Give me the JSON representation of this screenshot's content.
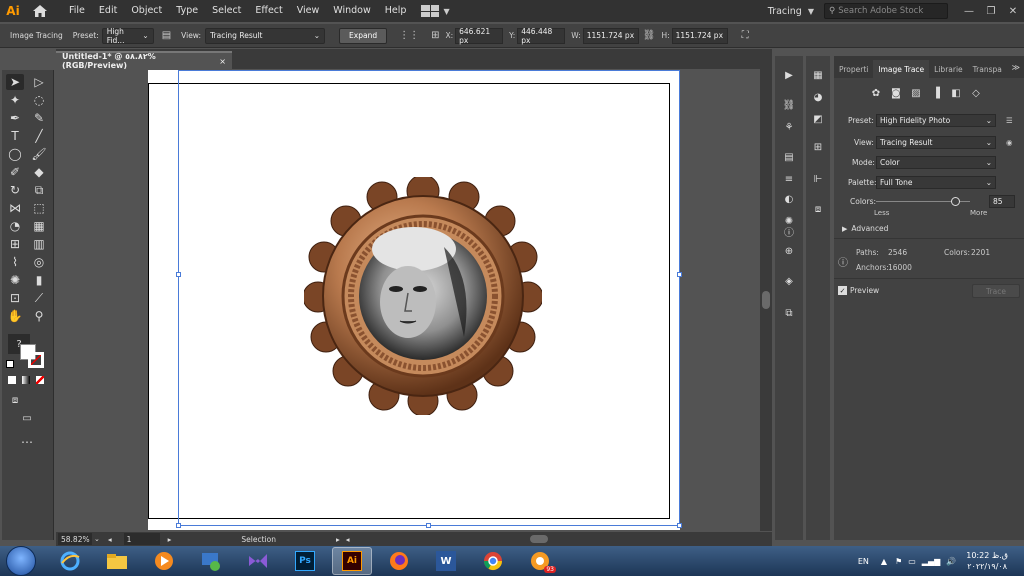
{
  "menubar": {
    "logo": "Ai",
    "items": [
      "File",
      "Edit",
      "Object",
      "Type",
      "Select",
      "Effect",
      "View",
      "Window",
      "Help"
    ],
    "workspace_label": "Tracing",
    "search_placeholder": "Search Adobe Stock",
    "window_buttons": [
      "—",
      "❐",
      "✕"
    ]
  },
  "controlbar": {
    "image_tracing_label": "Image Tracing",
    "preset_label": "Preset:",
    "preset_value": "High Fid...",
    "view_label": "View:",
    "view_value": "Tracing Result",
    "expand_button": "Expand",
    "x_label": "X:",
    "x_value": "646.621 px",
    "y_label": "Y:",
    "y_value": "446.448 px",
    "w_label": "W:",
    "w_value": "1151.724 px",
    "h_label": "H:",
    "h_value": "1151.724 px"
  },
  "document": {
    "tab_title": "Untitled-1* @ ٥٨.٨٢% (RGB/Preview)",
    "close": "×"
  },
  "statusbar": {
    "zoom": "58.82%",
    "artboard": "1",
    "tool": "Selection"
  },
  "panel": {
    "tabs": [
      "Properti",
      "Image Trace",
      "Librarie",
      "Transpa"
    ],
    "active_tab": "Image Trace",
    "preset_label": "Preset:",
    "preset_value": "High Fidelity Photo",
    "view_label": "View:",
    "view_value": "Tracing Result",
    "mode_label": "Mode:",
    "mode_value": "Color",
    "palette_label": "Palette:",
    "palette_value": "Full Tone",
    "colors_label": "Colors:",
    "colors_value": "85",
    "colors_fraction": 0.85,
    "less_label": "Less",
    "more_label": "More",
    "advanced_label": "Advanced",
    "paths_label": "Paths:",
    "paths_value": "2546",
    "colors_stat_label": "Colors:",
    "colors_stat_value": "2201",
    "anchors_label": "Anchors:",
    "anchors_value": "16000",
    "preview_label": "Preview",
    "preview_checked": true,
    "trace_button": "Trace"
  },
  "taskbar": {
    "apps": [
      "internet-explorer",
      "file-explorer",
      "media-player",
      "media-center",
      "visual-studio",
      "photoshop",
      "illustrator",
      "firefox",
      "word",
      "chrome",
      "app-badge"
    ],
    "active_app": "illustrator",
    "ps_label": "Ps",
    "ai_label": "Ai",
    "word_label": "W",
    "badge_count": "93",
    "language": "EN",
    "time": "10:22 ق.ظ",
    "date": "٢٠٢٢/١٩/٠٨"
  },
  "colors": {
    "ai_orange": "#ff9a00",
    "selection_blue": "#4a7bd8"
  }
}
